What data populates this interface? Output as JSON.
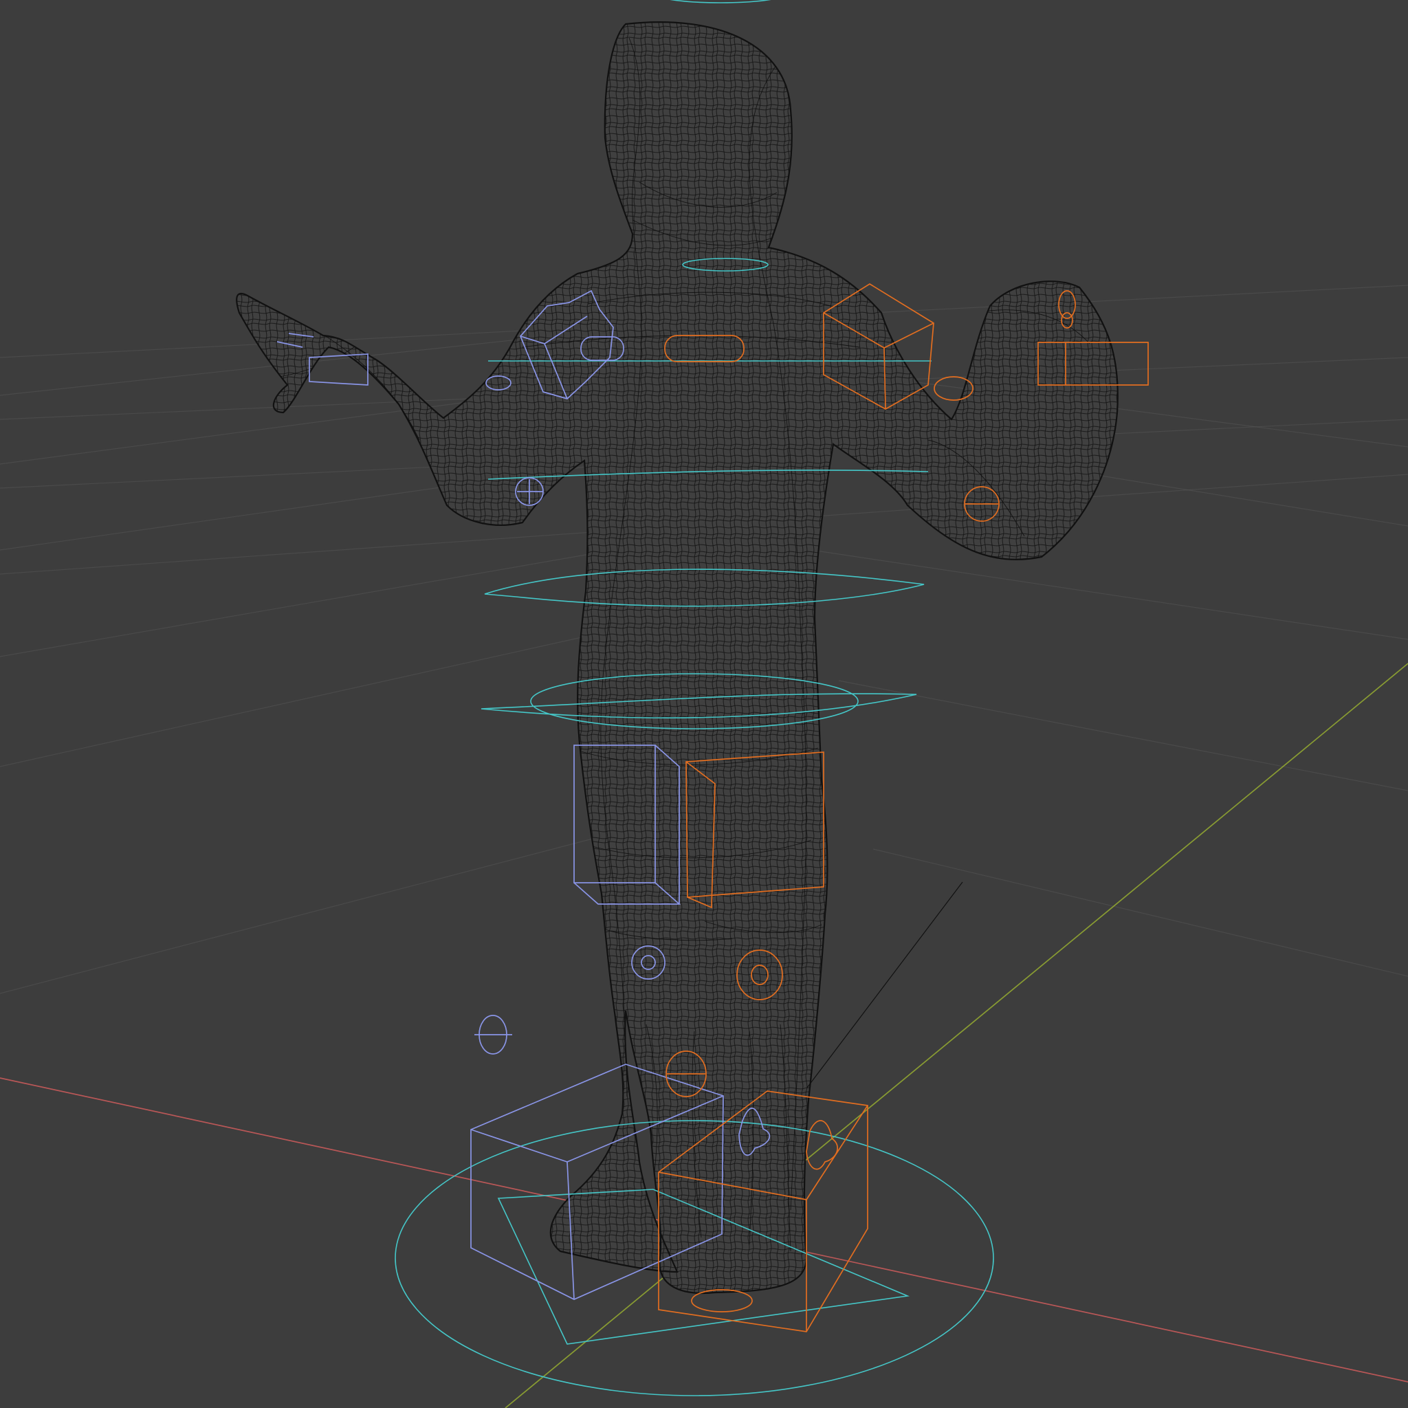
{
  "viewport": {
    "background_color": "#3d3d3d",
    "grid_color": "#555555",
    "x_axis_color": "#c85a5a",
    "y_axis_color": "#8ea232",
    "mesh_color": "#111111",
    "rig_center_color": "#45c7c8",
    "rig_left_color": "#8a95e7",
    "rig_right_color": "#e36e20"
  }
}
